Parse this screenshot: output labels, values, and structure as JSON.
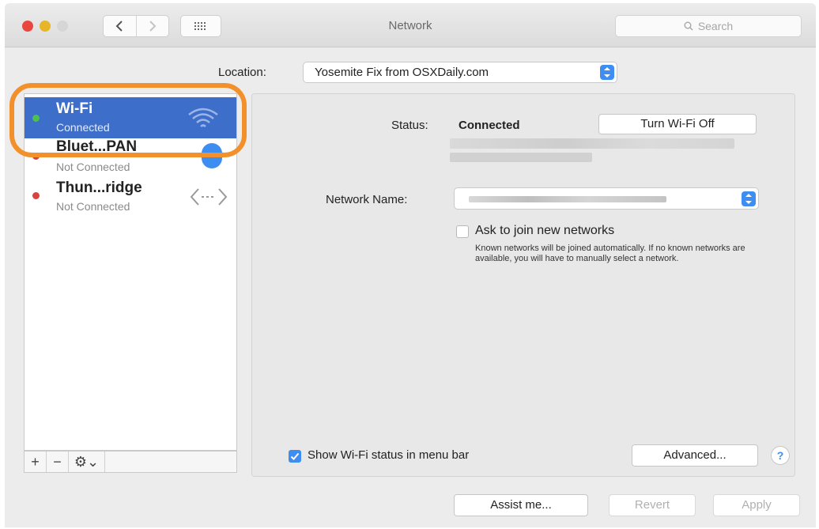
{
  "window": {
    "title": "Network",
    "search_placeholder": "Search"
  },
  "location": {
    "label": "Location:",
    "value": "Yosemite Fix from OSXDaily.com"
  },
  "services": [
    {
      "name": "Wi-Fi",
      "status": "Connected",
      "dot_color": "#4cc24c",
      "icon": "wifi-icon",
      "selected": true
    },
    {
      "name": "Bluet...PAN",
      "status": "Not Connected",
      "dot_color": "#d9433c",
      "icon": "bluetooth-icon",
      "selected": false
    },
    {
      "name": "Thun...ridge",
      "status": "Not Connected",
      "dot_color": "#d9433c",
      "icon": "thunderbolt-bridge-icon",
      "selected": false
    }
  ],
  "sidebar_footer": {
    "add": "+",
    "remove": "−",
    "gear": "⚙⌄"
  },
  "detail": {
    "status_label": "Status:",
    "status_value": "Connected",
    "turn_off_label": "Turn Wi-Fi Off",
    "network_name_label": "Network Name:",
    "ask_join_label": "Ask to join new networks",
    "ask_join_checked": false,
    "ask_join_help": "Known networks will be joined automatically. If no known networks are available, you will have to manually select a network.",
    "show_status_label": "Show Wi-Fi status in menu bar",
    "show_status_checked": true,
    "advanced_label": "Advanced...",
    "help_label": "?"
  },
  "bottom": {
    "assist_label": "Assist me...",
    "revert_label": "Revert",
    "apply_label": "Apply"
  },
  "colors": {
    "selection": "#3d6ec9",
    "accent": "#3d8ef0",
    "highlight_ring": "#f2902c"
  }
}
